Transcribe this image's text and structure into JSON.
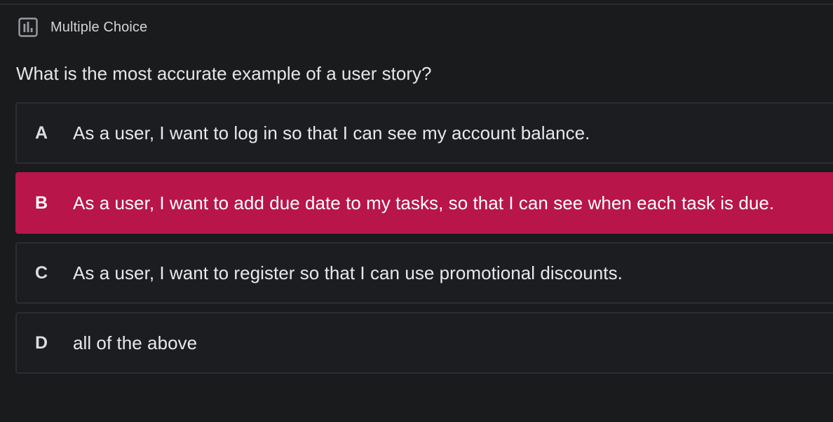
{
  "header": {
    "icon": "poll-chart-icon",
    "type_label": "Multiple Choice"
  },
  "question": {
    "text": "What is the most accurate example of a user story?"
  },
  "options": [
    {
      "letter": "A",
      "text": "As a user, I want to log in so that I can see my account balance.",
      "selected": false
    },
    {
      "letter": "B",
      "text": "As a user, I want to add due date to my tasks, so that I can see when each task is due.",
      "selected": true
    },
    {
      "letter": "C",
      "text": "As a user, I want to register so that I can use promotional discounts.",
      "selected": false
    },
    {
      "letter": "D",
      "text": "all of the above",
      "selected": false
    }
  ],
  "colors": {
    "background": "#1a1b1d",
    "selected_accent": "#b8154a",
    "option_border": "#2c2d30"
  }
}
